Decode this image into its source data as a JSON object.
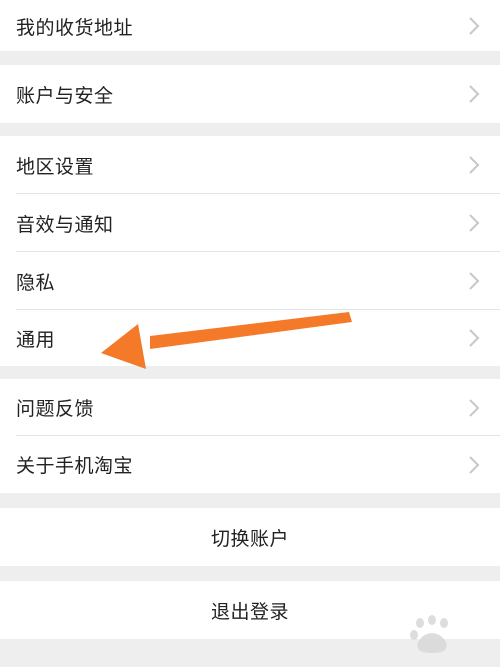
{
  "settings": {
    "groups": [
      {
        "items": [
          {
            "label": "我的收货地址"
          }
        ]
      },
      {
        "items": [
          {
            "label": "账户与安全"
          }
        ]
      },
      {
        "items": [
          {
            "label": "地区设置"
          },
          {
            "label": "音效与通知"
          },
          {
            "label": "隐私"
          },
          {
            "label": "通用"
          }
        ]
      },
      {
        "items": [
          {
            "label": "问题反馈"
          },
          {
            "label": "关于手机淘宝"
          }
        ]
      }
    ],
    "switch_account": "切换账户",
    "logout": "退出登录"
  },
  "annotation": {
    "arrow_color": "#f47a2a",
    "points_to": "通用"
  },
  "colors": {
    "background": "#eeeeee",
    "row": "#ffffff",
    "text": "#222222",
    "chevron": "#c7c7cc",
    "separator": "#e4e4e4"
  }
}
